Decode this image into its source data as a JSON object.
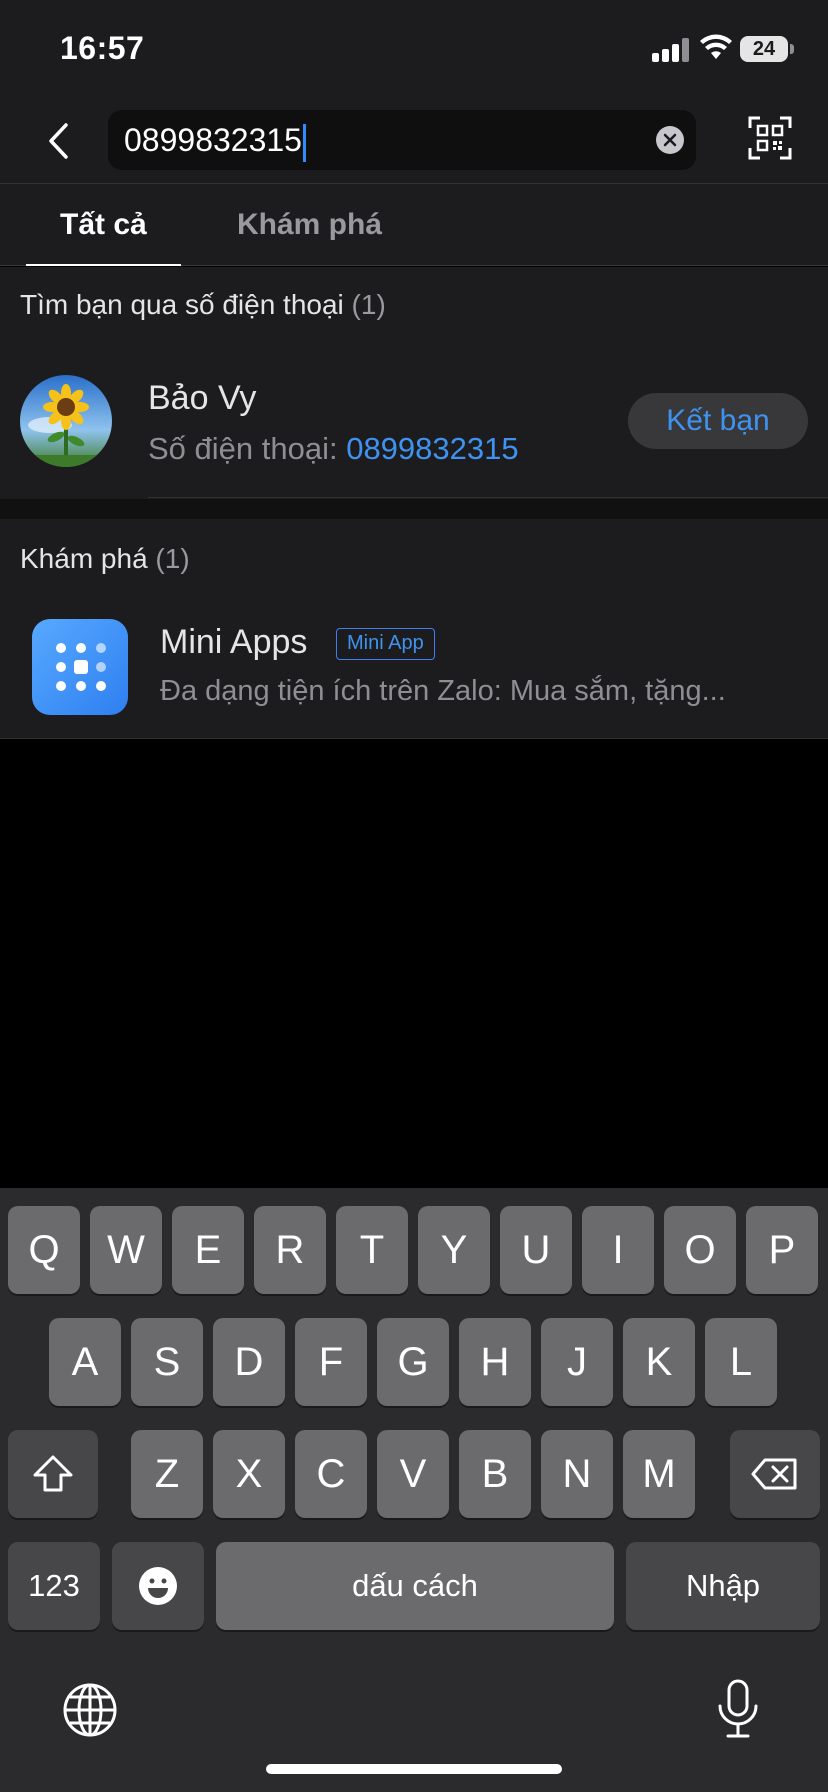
{
  "status_bar": {
    "time": "16:57",
    "battery": "24"
  },
  "search": {
    "value": "0899832315"
  },
  "tabs": [
    {
      "label": "Tất cả",
      "active": true
    },
    {
      "label": "Khám phá",
      "active": false
    }
  ],
  "phone_section": {
    "title": "Tìm bạn qua số điện thoại",
    "count": "(1)",
    "contact": {
      "name": "Bảo Vy",
      "phone_label": "Số điện thoại: ",
      "phone": "0899832315",
      "button": "Kết bạn"
    }
  },
  "discover_section": {
    "title": "Khám phá",
    "count": "(1)",
    "item": {
      "name": "Mini Apps",
      "badge": "Mini App",
      "description": "Đa dạng tiện ích trên Zalo: Mua sắm, tặng..."
    }
  },
  "keyboard": {
    "row1": [
      "Q",
      "W",
      "E",
      "R",
      "T",
      "Y",
      "U",
      "I",
      "O",
      "P"
    ],
    "row2": [
      "A",
      "S",
      "D",
      "F",
      "G",
      "H",
      "J",
      "K",
      "L"
    ],
    "row3": [
      "Z",
      "X",
      "C",
      "V",
      "B",
      "N",
      "M"
    ],
    "numbers_key": "123",
    "space_key": "dấu cách",
    "return_key": "Nhập"
  },
  "colors": {
    "accent": "#3f93f0",
    "panel": "#1c1c1e"
  }
}
